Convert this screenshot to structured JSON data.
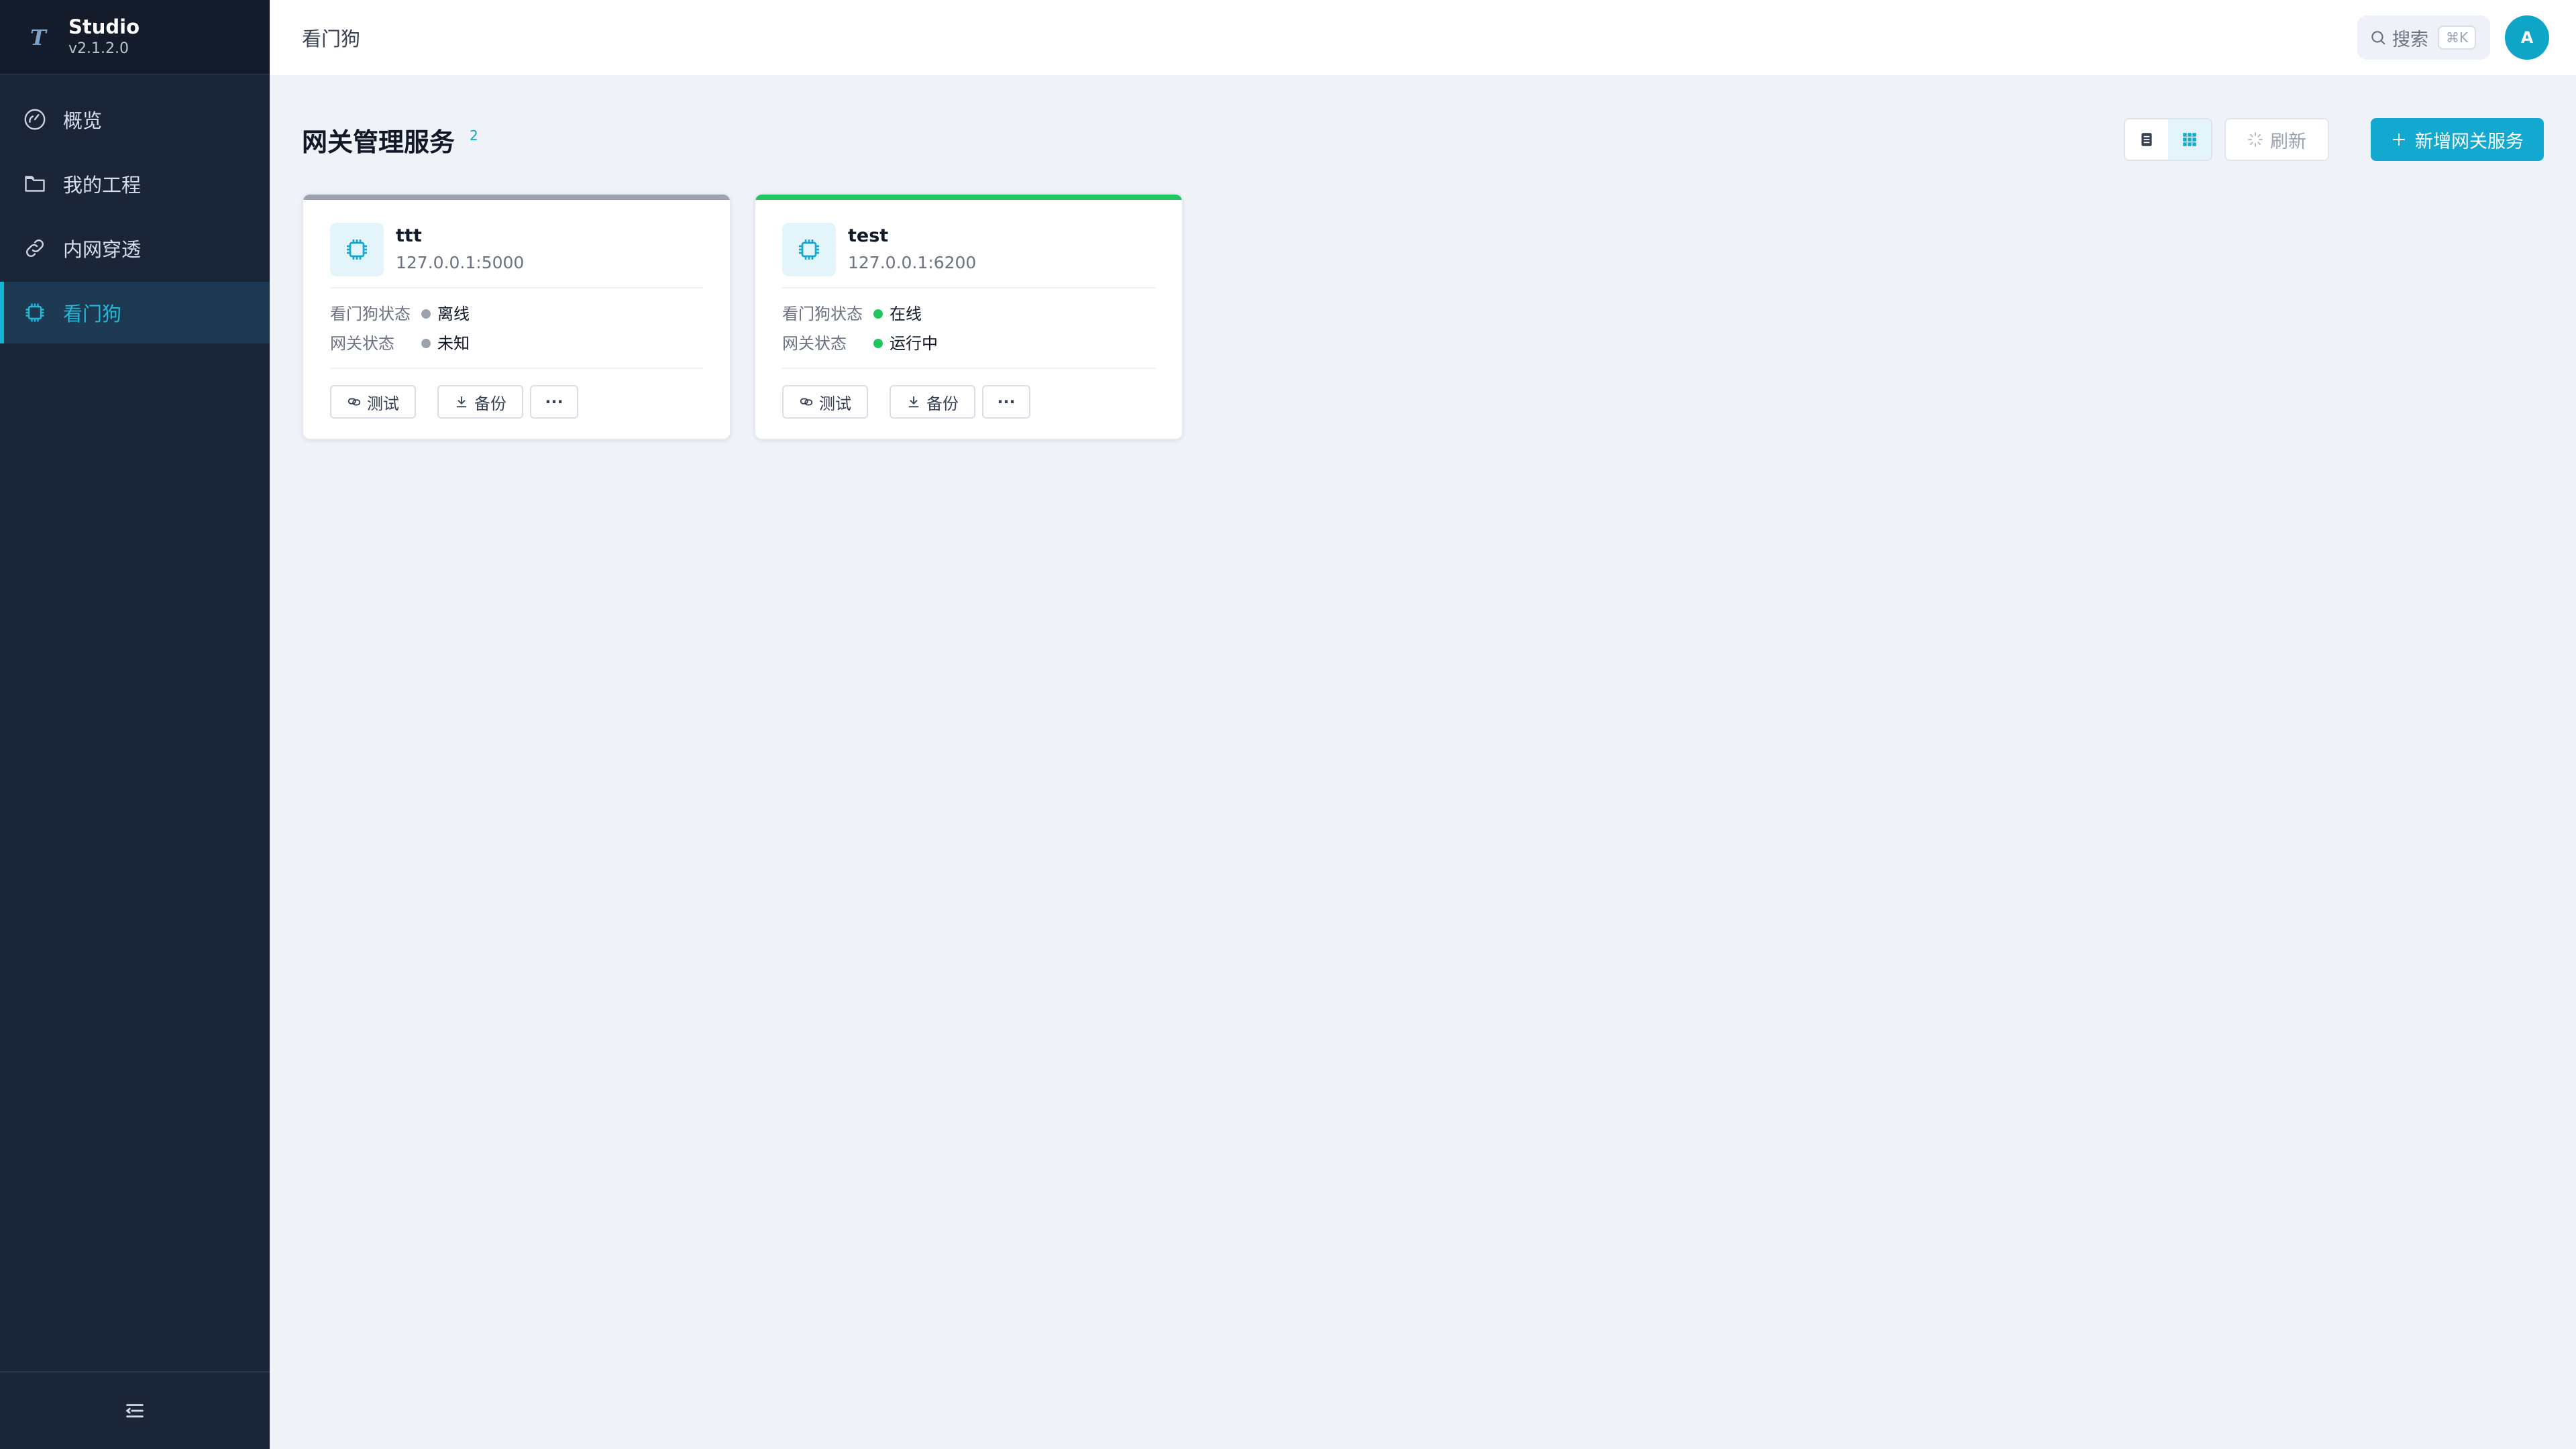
{
  "app": {
    "name": "Studio",
    "version": "v2.1.2.0",
    "logo_letter": "T"
  },
  "sidebar": {
    "items": [
      {
        "label": "概览",
        "icon": "gauge-icon",
        "active": false
      },
      {
        "label": "我的工程",
        "icon": "folder-icon",
        "active": false
      },
      {
        "label": "内网穿透",
        "icon": "link-icon",
        "active": false
      },
      {
        "label": "看门狗",
        "icon": "chip-icon",
        "active": true
      }
    ],
    "collapse_icon": "collapse-menu-icon"
  },
  "topbar": {
    "title": "看门狗",
    "search_label": "搜索",
    "search_shortcut": "⌘K",
    "avatar_letter": "A"
  },
  "page": {
    "title": "网关管理服务",
    "count": "2",
    "refresh_label": "刷新",
    "add_label": "新增网关服务",
    "view_mode": "grid"
  },
  "cards": [
    {
      "name": "ttt",
      "address": "127.0.0.1:5000",
      "watchdog_label": "看门狗状态",
      "watchdog_value": "离线",
      "gateway_label": "网关状态",
      "gateway_value": "未知",
      "top_color": "#9ca3af",
      "watchdog_dot": "#9ca3af",
      "gateway_dot": "#9ca3af",
      "test_label": "测试",
      "backup_label": "备份",
      "more_label": "···"
    },
    {
      "name": "test",
      "address": "127.0.0.1:6200",
      "watchdog_label": "看门狗状态",
      "watchdog_value": "在线",
      "gateway_label": "网关状态",
      "gateway_value": "运行中",
      "top_color": "#22c55e",
      "watchdog_dot": "#22c55e",
      "gateway_dot": "#22c55e",
      "test_label": "测试",
      "backup_label": "备份",
      "more_label": "···"
    }
  ],
  "colors": {
    "sidebar_bg": "#1b2538",
    "accent": "#13a8d0",
    "online": "#22c55e",
    "offline": "#9ca3af"
  }
}
